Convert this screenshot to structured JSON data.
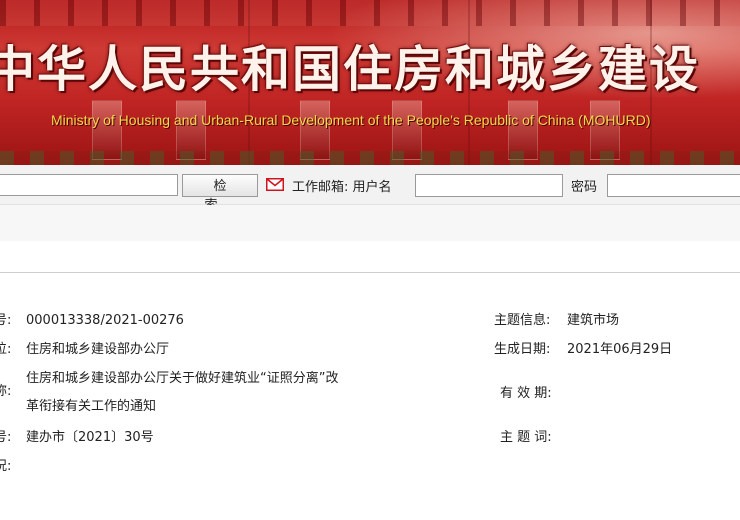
{
  "banner": {
    "title": "中华人民共和国住房和城乡建设",
    "subtitle": "Ministry of Housing and Urban-Rural Development of the People's Republic of China (MOHURD)"
  },
  "toolbar": {
    "search_button_label": "检索",
    "mail_icon": "envelope-icon",
    "mail_label": "工作邮箱: 用户名",
    "password_label": "密码",
    "accent_color": "#d0141e"
  },
  "document": {
    "rows_left": [
      {
        "label": "号:",
        "value": "000013338/2021-00276"
      },
      {
        "label": "位:",
        "value": "住房和城乡建设部办公厅"
      },
      {
        "label": "称:",
        "value_line1": "住房和城乡建设部办公厅关于做好建筑业“证照分离”改",
        "value_line2": "革衔接有关工作的通知"
      },
      {
        "label": "号:",
        "value": "建办市〔2021〕30号"
      },
      {
        "label": "况:",
        "value": ""
      }
    ],
    "rows_right": [
      {
        "label": "主题信息:",
        "value": "建筑市场"
      },
      {
        "label": "生成日期:",
        "value": "2021年06月29日"
      },
      {
        "label": "有 效 期:",
        "value": ""
      },
      {
        "label": "主 题 词:",
        "value": ""
      }
    ]
  }
}
